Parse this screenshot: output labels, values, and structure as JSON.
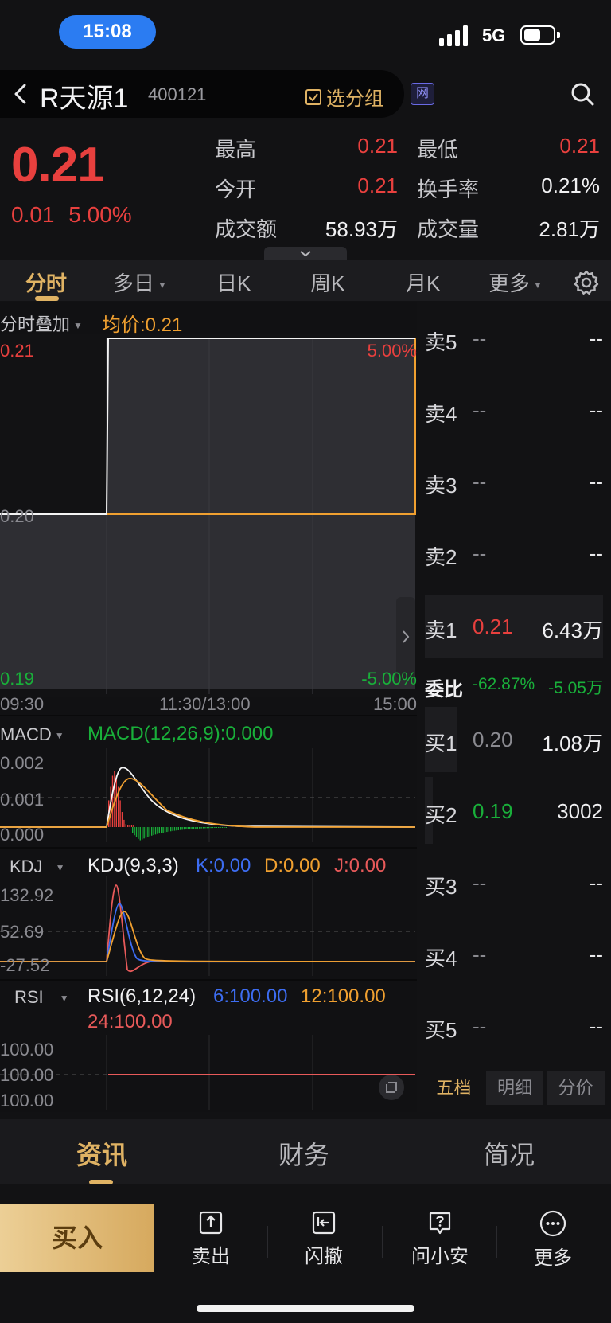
{
  "status_bar": {
    "time": "15:08",
    "network": "5G",
    "battery_level": 0.55
  },
  "header": {
    "stock_name": "R天源1",
    "stock_code": "400121",
    "group_button": "选分组",
    "net_badge": "网"
  },
  "quote": {
    "price": "0.21",
    "change": "0.01",
    "change_pct": "5.00%",
    "stats": [
      {
        "label": "最高",
        "value": "0.21",
        "color": "red"
      },
      {
        "label": "最低",
        "value": "0.21",
        "color": "red"
      },
      {
        "label": "今开",
        "value": "0.21",
        "color": "red"
      },
      {
        "label": "换手率",
        "value": "0.21%",
        "color": "white"
      },
      {
        "label": "成交额",
        "value": "58.93万",
        "color": "white"
      },
      {
        "label": "成交量",
        "value": "2.81万",
        "color": "white"
      }
    ]
  },
  "period_tabs": [
    "分时",
    "多日",
    "日K",
    "周K",
    "月K",
    "更多"
  ],
  "active_period": "分时",
  "intraday": {
    "overlay_label": "分时叠加",
    "avg_price_label": "均价:0.21",
    "y_top": "0.21",
    "y_mid": "0.20",
    "y_bottom": "0.19",
    "pct_top": "5.00%",
    "pct_bottom": "-5.00%",
    "time_start": "09:30",
    "time_mid": "11:30/13:00",
    "time_end": "15:00"
  },
  "macd": {
    "selector": "MACD",
    "title": "MACD(12,26,9):0.000",
    "levels": [
      "0.002",
      "0.001",
      "0.000"
    ]
  },
  "kdj": {
    "selector": "KDJ",
    "title": "KDJ(9,3,3)",
    "k": "K:0.00",
    "d": "D:0.00",
    "j": "J:0.00",
    "levels": [
      "132.92",
      "52.69",
      "-27.52"
    ]
  },
  "rsi": {
    "selector": "RSI",
    "title": "RSI(6,12,24)",
    "r6": "6:100.00",
    "r12": "12:100.00",
    "r24": "24:100.00",
    "levels": [
      "100.00",
      "100.00",
      "100.00"
    ]
  },
  "order_book": {
    "sells": [
      {
        "label": "卖5",
        "price": "--",
        "volume": "--"
      },
      {
        "label": "卖4",
        "price": "--",
        "volume": "--"
      },
      {
        "label": "卖3",
        "price": "--",
        "volume": "--"
      },
      {
        "label": "卖2",
        "price": "--",
        "volume": "--"
      },
      {
        "label": "卖1",
        "price": "0.21",
        "volume": "6.43万"
      }
    ],
    "ratio_label": "委比",
    "ratio_pct": "-62.87%",
    "ratio_vol": "-5.05万",
    "buys": [
      {
        "label": "买1",
        "price": "0.20",
        "volume": "1.08万"
      },
      {
        "label": "买2",
        "price": "0.19",
        "volume": "3002"
      },
      {
        "label": "买3",
        "price": "--",
        "volume": "--"
      },
      {
        "label": "买4",
        "price": "--",
        "volume": "--"
      },
      {
        "label": "买5",
        "price": "--",
        "volume": "--"
      }
    ],
    "tabs": [
      "五档",
      "明细",
      "分价"
    ]
  },
  "news_tabs": [
    "资讯",
    "财务",
    "简况"
  ],
  "actions": {
    "buy": "买入",
    "sell": "卖出",
    "cancel": "闪撤",
    "ask": "问小安",
    "more": "更多"
  }
}
